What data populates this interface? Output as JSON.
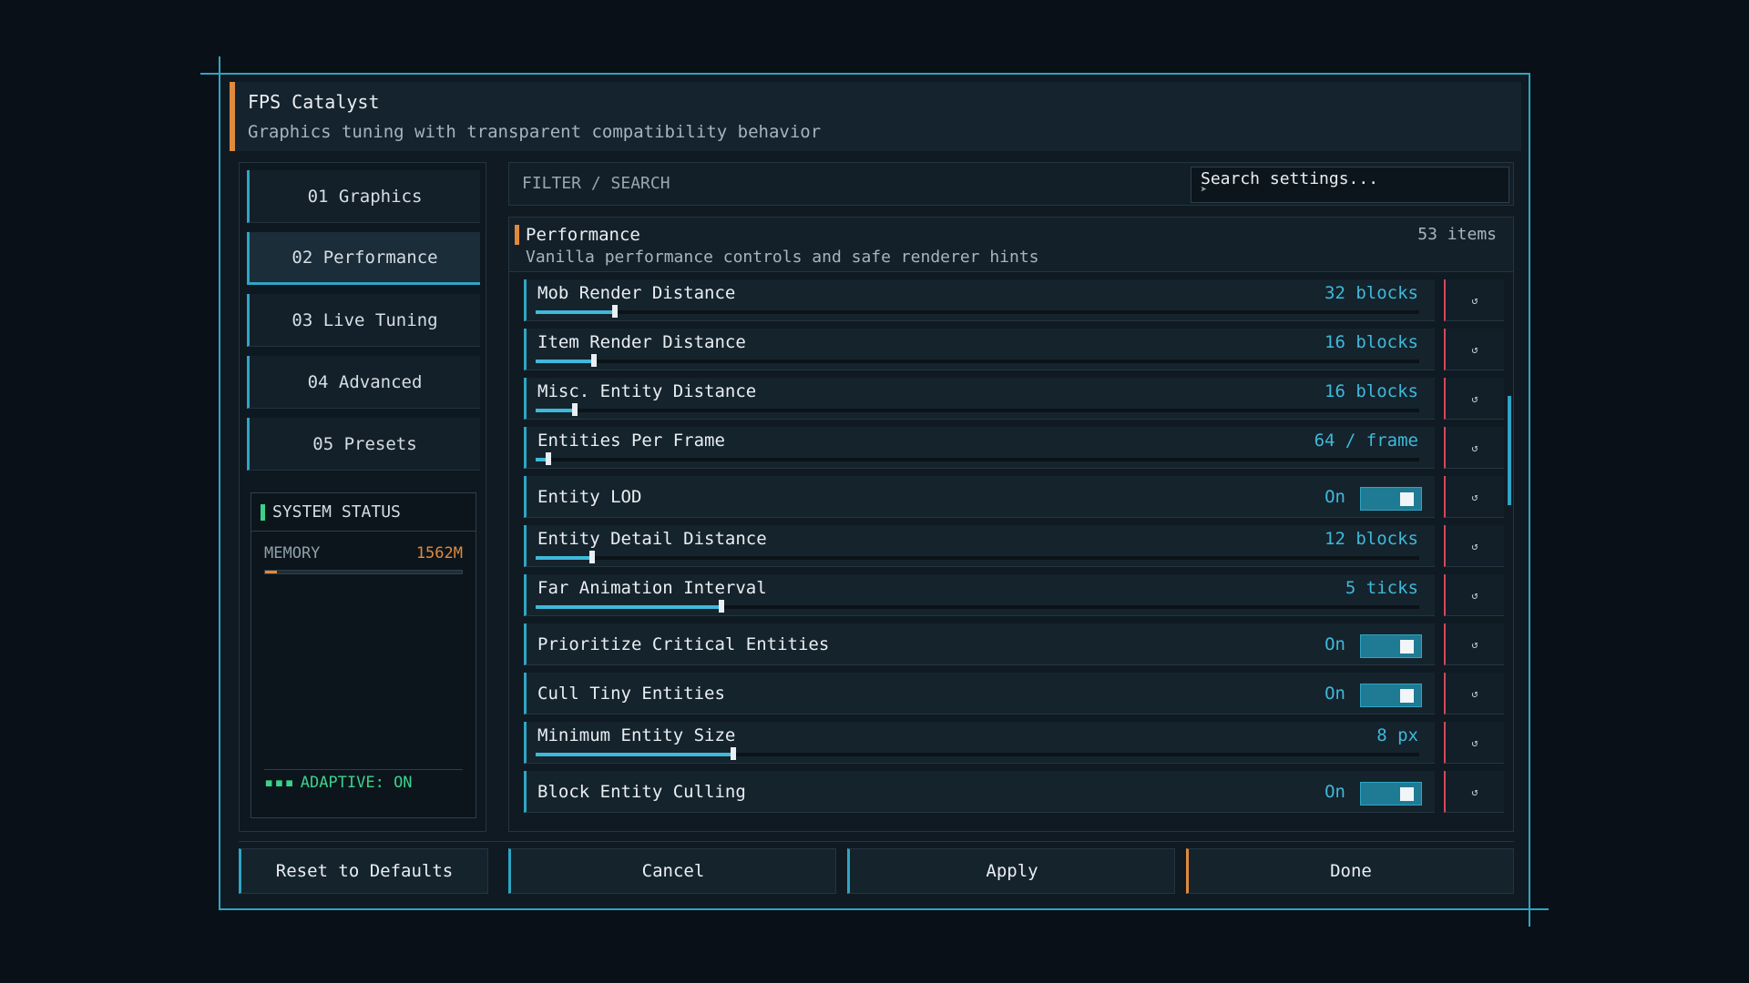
{
  "header": {
    "title": "FPS Catalyst",
    "subtitle": "Graphics tuning with transparent compatibility behavior"
  },
  "tabs": [
    {
      "label": "01  Graphics",
      "active": false
    },
    {
      "label": "02  Performance",
      "active": true
    },
    {
      "label": "03  Live Tuning",
      "active": false
    },
    {
      "label": "04  Advanced",
      "active": false
    },
    {
      "label": "05  Presets",
      "active": false
    }
  ],
  "status": {
    "title": "SYSTEM STATUS",
    "memory_label": "MEMORY",
    "memory_value": "1562M",
    "memory_fraction": 0.06,
    "adaptive_dots": "▪▪▪",
    "adaptive": "ADAPTIVE: ON"
  },
  "search": {
    "label": "FILTER / SEARCH",
    "placeholder": "Search settings..."
  },
  "section": {
    "name": "Performance",
    "description": "Vanilla performance controls and safe renderer hints",
    "count": "53 items"
  },
  "reset_glyph": "↺",
  "settings": [
    {
      "label": "Mob Render Distance",
      "type": "slider",
      "value": "32 blocks",
      "fraction": 0.09
    },
    {
      "label": "Item Render Distance",
      "type": "slider",
      "value": "16 blocks",
      "fraction": 0.066
    },
    {
      "label": "Misc. Entity Distance",
      "type": "slider",
      "value": "16 blocks",
      "fraction": 0.044
    },
    {
      "label": "Entities Per Frame",
      "type": "slider",
      "value": "64 / frame",
      "fraction": 0.014
    },
    {
      "label": "Entity LOD",
      "type": "toggle",
      "value": "On"
    },
    {
      "label": "Entity Detail Distance",
      "type": "slider",
      "value": "12 blocks",
      "fraction": 0.064
    },
    {
      "label": "Far Animation Interval",
      "type": "slider",
      "value": "5 ticks",
      "fraction": 0.21
    },
    {
      "label": "Prioritize Critical Entities",
      "type": "toggle",
      "value": "On"
    },
    {
      "label": "Cull Tiny Entities",
      "type": "toggle",
      "value": "On"
    },
    {
      "label": "Minimum Entity Size",
      "type": "slider",
      "value": "8 px",
      "fraction": 0.224
    },
    {
      "label": "Block Entity Culling",
      "type": "toggle",
      "value": "On"
    }
  ],
  "buttons": {
    "reset": "Reset to Defaults",
    "cancel": "Cancel",
    "apply": "Apply",
    "done": "Done"
  },
  "colors": {
    "accent": "#2fa5c4",
    "highlight": "#e08a3c",
    "value": "#3fb9da",
    "ok": "#3bd28a",
    "danger": "#d2485a"
  }
}
